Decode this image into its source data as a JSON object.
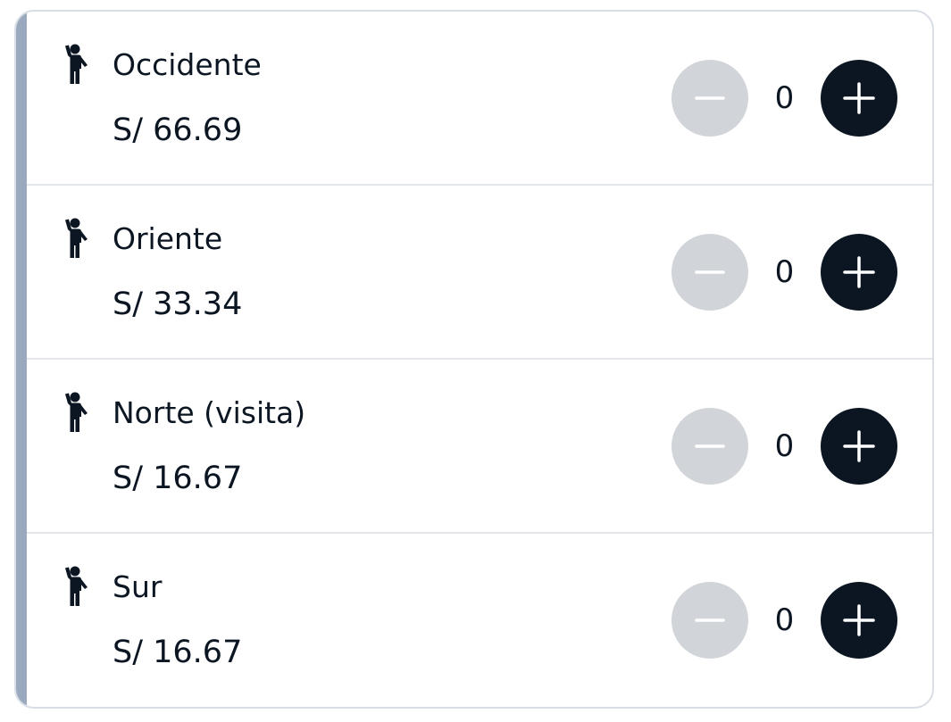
{
  "zones": [
    {
      "name": "Occidente",
      "price": "S/ 66.69",
      "quantity": "0"
    },
    {
      "name": "Oriente",
      "price": "S/ 33.34",
      "quantity": "0"
    },
    {
      "name": "Norte (visita)",
      "price": "S/ 16.67",
      "quantity": "0"
    },
    {
      "name": "Sur",
      "price": "S/ 16.67",
      "quantity": "0"
    }
  ],
  "icons": {
    "zone": "person-waving-icon",
    "decrement": "minus-icon",
    "increment": "plus-icon"
  },
  "colors": {
    "accent_bar": "#9aa9bd",
    "text": "#0b1622",
    "decrement_disabled_bg": "#d1d4d8",
    "increment_bg": "#0b1622",
    "card_border": "#d9dee6"
  }
}
